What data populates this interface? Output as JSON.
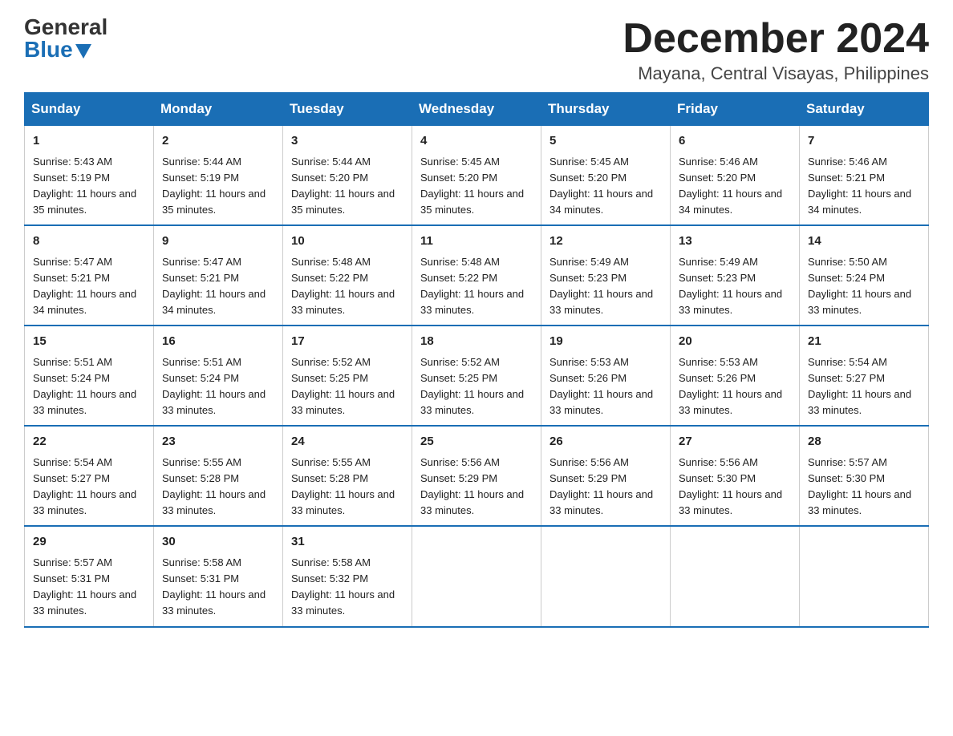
{
  "header": {
    "logo_general": "General",
    "logo_blue": "Blue",
    "month_title": "December 2024",
    "location": "Mayana, Central Visayas, Philippines"
  },
  "days_of_week": [
    "Sunday",
    "Monday",
    "Tuesday",
    "Wednesday",
    "Thursday",
    "Friday",
    "Saturday"
  ],
  "weeks": [
    [
      {
        "day": "1",
        "sunrise": "5:43 AM",
        "sunset": "5:19 PM",
        "daylight": "11 hours and 35 minutes."
      },
      {
        "day": "2",
        "sunrise": "5:44 AM",
        "sunset": "5:19 PM",
        "daylight": "11 hours and 35 minutes."
      },
      {
        "day": "3",
        "sunrise": "5:44 AM",
        "sunset": "5:20 PM",
        "daylight": "11 hours and 35 minutes."
      },
      {
        "day": "4",
        "sunrise": "5:45 AM",
        "sunset": "5:20 PM",
        "daylight": "11 hours and 35 minutes."
      },
      {
        "day": "5",
        "sunrise": "5:45 AM",
        "sunset": "5:20 PM",
        "daylight": "11 hours and 34 minutes."
      },
      {
        "day": "6",
        "sunrise": "5:46 AM",
        "sunset": "5:20 PM",
        "daylight": "11 hours and 34 minutes."
      },
      {
        "day": "7",
        "sunrise": "5:46 AM",
        "sunset": "5:21 PM",
        "daylight": "11 hours and 34 minutes."
      }
    ],
    [
      {
        "day": "8",
        "sunrise": "5:47 AM",
        "sunset": "5:21 PM",
        "daylight": "11 hours and 34 minutes."
      },
      {
        "day": "9",
        "sunrise": "5:47 AM",
        "sunset": "5:21 PM",
        "daylight": "11 hours and 34 minutes."
      },
      {
        "day": "10",
        "sunrise": "5:48 AM",
        "sunset": "5:22 PM",
        "daylight": "11 hours and 33 minutes."
      },
      {
        "day": "11",
        "sunrise": "5:48 AM",
        "sunset": "5:22 PM",
        "daylight": "11 hours and 33 minutes."
      },
      {
        "day": "12",
        "sunrise": "5:49 AM",
        "sunset": "5:23 PM",
        "daylight": "11 hours and 33 minutes."
      },
      {
        "day": "13",
        "sunrise": "5:49 AM",
        "sunset": "5:23 PM",
        "daylight": "11 hours and 33 minutes."
      },
      {
        "day": "14",
        "sunrise": "5:50 AM",
        "sunset": "5:24 PM",
        "daylight": "11 hours and 33 minutes."
      }
    ],
    [
      {
        "day": "15",
        "sunrise": "5:51 AM",
        "sunset": "5:24 PM",
        "daylight": "11 hours and 33 minutes."
      },
      {
        "day": "16",
        "sunrise": "5:51 AM",
        "sunset": "5:24 PM",
        "daylight": "11 hours and 33 minutes."
      },
      {
        "day": "17",
        "sunrise": "5:52 AM",
        "sunset": "5:25 PM",
        "daylight": "11 hours and 33 minutes."
      },
      {
        "day": "18",
        "sunrise": "5:52 AM",
        "sunset": "5:25 PM",
        "daylight": "11 hours and 33 minutes."
      },
      {
        "day": "19",
        "sunrise": "5:53 AM",
        "sunset": "5:26 PM",
        "daylight": "11 hours and 33 minutes."
      },
      {
        "day": "20",
        "sunrise": "5:53 AM",
        "sunset": "5:26 PM",
        "daylight": "11 hours and 33 minutes."
      },
      {
        "day": "21",
        "sunrise": "5:54 AM",
        "sunset": "5:27 PM",
        "daylight": "11 hours and 33 minutes."
      }
    ],
    [
      {
        "day": "22",
        "sunrise": "5:54 AM",
        "sunset": "5:27 PM",
        "daylight": "11 hours and 33 minutes."
      },
      {
        "day": "23",
        "sunrise": "5:55 AM",
        "sunset": "5:28 PM",
        "daylight": "11 hours and 33 minutes."
      },
      {
        "day": "24",
        "sunrise": "5:55 AM",
        "sunset": "5:28 PM",
        "daylight": "11 hours and 33 minutes."
      },
      {
        "day": "25",
        "sunrise": "5:56 AM",
        "sunset": "5:29 PM",
        "daylight": "11 hours and 33 minutes."
      },
      {
        "day": "26",
        "sunrise": "5:56 AM",
        "sunset": "5:29 PM",
        "daylight": "11 hours and 33 minutes."
      },
      {
        "day": "27",
        "sunrise": "5:56 AM",
        "sunset": "5:30 PM",
        "daylight": "11 hours and 33 minutes."
      },
      {
        "day": "28",
        "sunrise": "5:57 AM",
        "sunset": "5:30 PM",
        "daylight": "11 hours and 33 minutes."
      }
    ],
    [
      {
        "day": "29",
        "sunrise": "5:57 AM",
        "sunset": "5:31 PM",
        "daylight": "11 hours and 33 minutes."
      },
      {
        "day": "30",
        "sunrise": "5:58 AM",
        "sunset": "5:31 PM",
        "daylight": "11 hours and 33 minutes."
      },
      {
        "day": "31",
        "sunrise": "5:58 AM",
        "sunset": "5:32 PM",
        "daylight": "11 hours and 33 minutes."
      },
      null,
      null,
      null,
      null
    ]
  ],
  "labels": {
    "sunrise_prefix": "Sunrise: ",
    "sunset_prefix": "Sunset: ",
    "daylight_prefix": "Daylight: "
  }
}
